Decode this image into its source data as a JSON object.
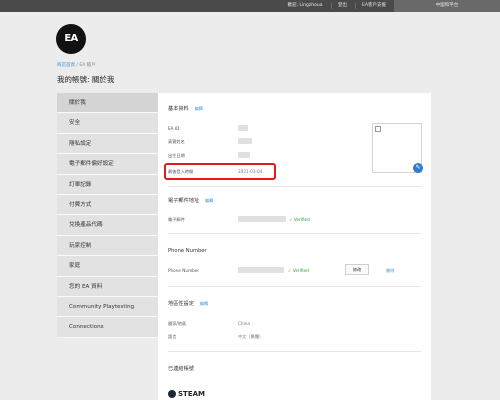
{
  "topbar": {
    "links": [
      "歡迎, Lingzhoua",
      "登出",
      "EA客戶支援"
    ],
    "language": "中國和平台"
  },
  "logo": {
    "text": "EA"
  },
  "breadcrumb": {
    "home": "商店首頁",
    "separator": " / ",
    "current": "EA 帳戶"
  },
  "page_title": "我的帳號: 關於我",
  "sidebar": {
    "items": [
      {
        "label": "關於我",
        "active": true
      },
      {
        "label": "安全"
      },
      {
        "label": "隱私設定"
      },
      {
        "label": "電子郵件偏好設定"
      },
      {
        "label": "訂單記錄"
      },
      {
        "label": "付費方式"
      },
      {
        "label": "兌換產品代碼"
      },
      {
        "label": "玩家控制"
      },
      {
        "label": "家庭"
      },
      {
        "label": "您的 EA 資料"
      },
      {
        "label": "Community Playtesting"
      },
      {
        "label": "Connections"
      }
    ]
  },
  "basic_info": {
    "title": "基本資料",
    "edit": "編輯",
    "fields": {
      "ea_id": "EA ID",
      "real_name": "真實姓名",
      "dob": "出生日期",
      "last_login_label": "最後登入時間",
      "last_login_value": "2021-03-04"
    }
  },
  "email": {
    "title": "電子郵件地址",
    "edit": "編輯",
    "label": "電子郵件",
    "status": "Verified",
    "check": "✓"
  },
  "phone": {
    "title": "Phone Number",
    "label": "Phone Number",
    "status": "Verified",
    "check": "✓",
    "edit_button": "修改",
    "remove_link": "刪除"
  },
  "region": {
    "title": "地區性設定",
    "edit": "編輯",
    "country_label": "國家/地區",
    "country_value": "China",
    "language_label": "語言",
    "language_value": "中文（繁體）"
  },
  "linked": {
    "title": "已連結帳號",
    "steam": "STEAM"
  },
  "colors": {
    "accent": "#3a8fd6",
    "verified": "#2f9a3a",
    "highlight": "#e01b1b"
  }
}
